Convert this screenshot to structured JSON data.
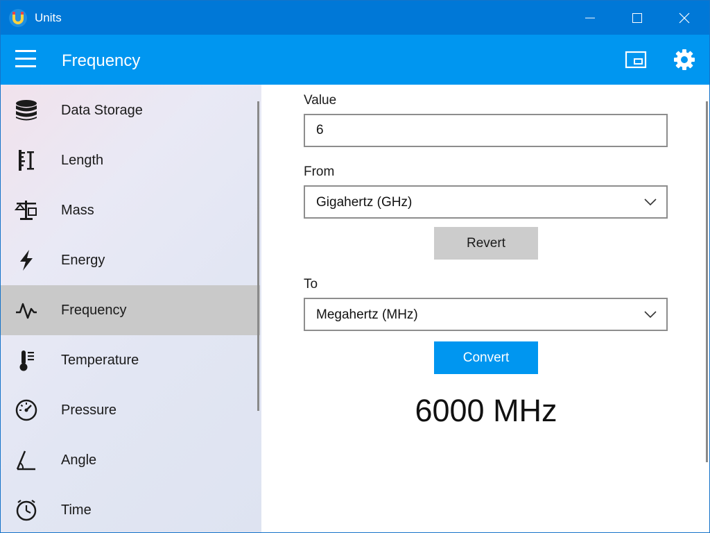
{
  "window": {
    "title": "Units",
    "accent": "#0078d7",
    "header_color": "#0096f0"
  },
  "header": {
    "title": "Frequency",
    "menu_icon": "hamburger-icon",
    "compact_icon": "compact-overlay-icon",
    "settings_icon": "gear-icon"
  },
  "sidebar": {
    "items": [
      {
        "label": "Data Storage",
        "icon": "database-icon",
        "selected": false
      },
      {
        "label": "Length",
        "icon": "ruler-icon",
        "selected": false
      },
      {
        "label": "Mass",
        "icon": "scale-icon",
        "selected": false
      },
      {
        "label": "Energy",
        "icon": "lightning-icon",
        "selected": false
      },
      {
        "label": "Frequency",
        "icon": "waveform-icon",
        "selected": true
      },
      {
        "label": "Temperature",
        "icon": "thermometer-icon",
        "selected": false
      },
      {
        "label": "Pressure",
        "icon": "gauge-icon",
        "selected": false
      },
      {
        "label": "Angle",
        "icon": "angle-icon",
        "selected": false
      },
      {
        "label": "Time",
        "icon": "clock-icon",
        "selected": false
      }
    ]
  },
  "main": {
    "value_label": "Value",
    "value": "6",
    "from_label": "From",
    "from_selected": "Gigahertz (GHz)",
    "revert_label": "Revert",
    "to_label": "To",
    "to_selected": "Megahertz (MHz)",
    "convert_label": "Convert",
    "result": "6000 MHz"
  }
}
